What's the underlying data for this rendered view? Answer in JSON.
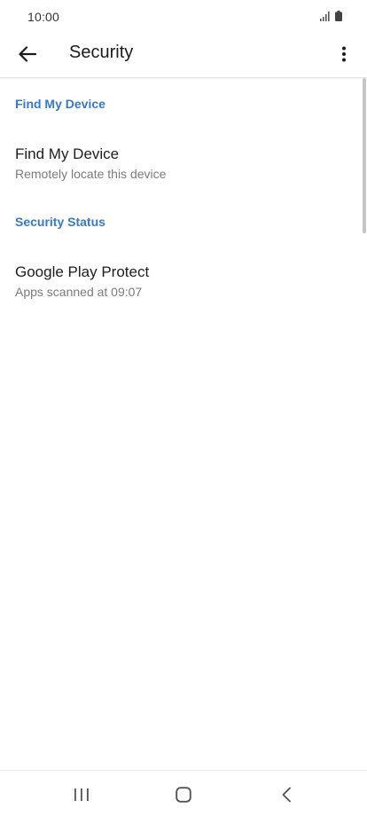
{
  "status_bar": {
    "time": "10:00",
    "icons": [
      "signal-icon",
      "battery-icon"
    ]
  },
  "app_bar": {
    "title": "Security",
    "back_icon": "arrow-left-icon",
    "menu_icon": "more-vert-icon"
  },
  "sections": [
    {
      "header": "Find My Device",
      "items": [
        {
          "title": "Find My Device",
          "subtitle": "Remotely locate this device"
        }
      ]
    },
    {
      "header": "Security Status",
      "items": [
        {
          "title": "Google Play Protect",
          "subtitle": "Apps scanned at 09:07"
        }
      ]
    }
  ],
  "nav_bar": {
    "icons": [
      "recents-icon",
      "home-icon",
      "back-icon"
    ]
  },
  "colors": {
    "accent": "#3478d4",
    "title_text": "#1d1d1d",
    "subtitle_text": "#7a7a7a"
  }
}
